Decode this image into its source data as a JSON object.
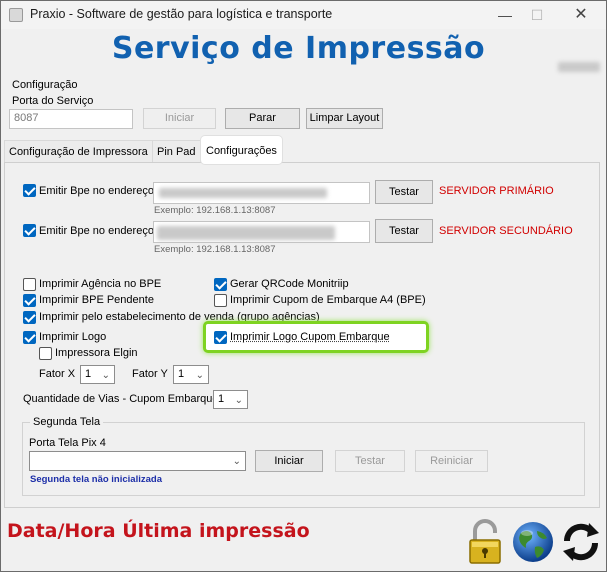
{
  "window": {
    "title": "Praxio - Software de gestão para logística e transporte",
    "minimize_glyph": "—",
    "maximize_glyph": "☐",
    "close_glyph": "✕"
  },
  "header": {
    "title": "Serviço de Impressão"
  },
  "config": {
    "section_label": "Configuração",
    "port_label": "Porta do Serviço",
    "port_value": "8087",
    "iniciar_label": "Iniciar",
    "parar_label": "Parar",
    "limpar_label": "Limpar Layout"
  },
  "tabs": [
    {
      "label": "Configuração de Impressora"
    },
    {
      "label": "Pin Pad"
    },
    {
      "label": "Configurações"
    }
  ],
  "servers": {
    "primary": {
      "checkbox_label": "Emitir Bpe no endereço:",
      "example": "Exemplo: 192.168.1.13:8087",
      "test_label": "Testar",
      "server_label": "SERVIDOR PRIMÁRIO"
    },
    "secondary": {
      "checkbox_label": "Emitir Bpe no endereço:",
      "example": "Exemplo: 192.168.1.13:8087",
      "test_label": "Testar",
      "server_label": "SERVIDOR SECUNDÁRIO"
    }
  },
  "options": {
    "imprimir_agencia": "Imprimir Agência no BPE",
    "imprimir_pendente": "Imprimir BPE Pendente",
    "imprimir_estabelecimento": "Imprimir pelo estabelecimento de venda (grupo agências)",
    "imprimir_logo": "Imprimir Logo",
    "impressora_elgin": "Impressora Elgin",
    "gerar_qrcode": "Gerar QRCode Monitriip",
    "imprimir_cupom_a4": "Imprimir Cupom de Embarque A4 (BPE)",
    "imprimir_logo_cupom": "Imprimir Logo Cupom Embarque"
  },
  "fatores": {
    "fator_x_label": "Fator X",
    "fator_x_value": "1",
    "fator_y_label": "Fator Y",
    "fator_y_value": "1",
    "vias_label": "Quantidade de Vias - Cupom Embarque",
    "vias_value": "1"
  },
  "segunda_tela": {
    "legend": "Segunda Tela",
    "port_label": "Porta Tela Pix 4",
    "port_value": "",
    "iniciar_label": "Iniciar",
    "testar_label": "Testar",
    "reiniciar_label": "Reiniciar",
    "status": "Segunda tela não inicializada"
  },
  "footer": {
    "last_print_label": "Data/Hora Última impressão"
  },
  "colors": {
    "title_blue": "#1161b0",
    "server_red": "#d10000",
    "footer_red": "#c4141c",
    "highlight_green": "#7ed321",
    "checkbox_blue": "#0067c0"
  },
  "icons": [
    "app-icon",
    "padlock-icon",
    "globe-icon",
    "refresh-icon",
    "dropdown-arrow-icon"
  ]
}
